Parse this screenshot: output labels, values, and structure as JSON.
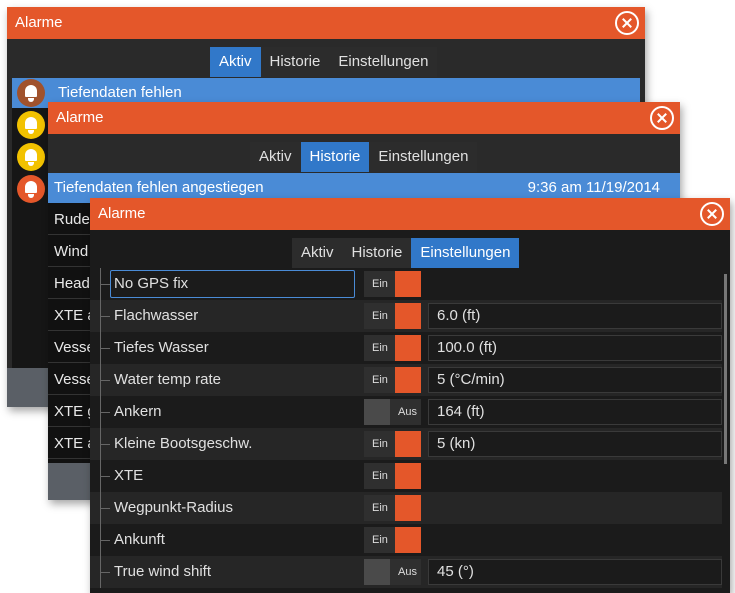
{
  "windows": {
    "active": {
      "title": "Alarme",
      "tabs": [
        "Aktiv",
        "Historie",
        "Einstellungen"
      ],
      "active_tab": "Aktiv",
      "alarm_text": "Tiefendaten fehlen",
      "bell_colors": [
        "#a0522d",
        "#f2c200",
        "#f2c200",
        "#e4572a"
      ]
    },
    "history": {
      "title": "Alarme",
      "tabs": [
        "Aktiv",
        "Historie",
        "Einstellungen"
      ],
      "active_tab": "Historie",
      "selected": {
        "text": "Tiefendaten fehlen angestiegen",
        "time": "9:36 am 11/19/2014"
      },
      "items": [
        "Rude",
        "Wind",
        "Head",
        "XTE a",
        "Vesse",
        "Vesse",
        "XTE g",
        "XTE a"
      ]
    },
    "settings": {
      "title": "Alarme",
      "tabs": [
        "Aktiv",
        "Historie",
        "Einstellungen"
      ],
      "active_tab": "Einstellungen",
      "on_label": "Ein",
      "off_label": "Aus",
      "rows": [
        {
          "name": "No GPS fix",
          "state": "on",
          "value": null,
          "selected": true
        },
        {
          "name": "Flachwasser",
          "state": "on",
          "value": "6.0 (ft)"
        },
        {
          "name": "Tiefes Wasser",
          "state": "on",
          "value": "100.0 (ft)"
        },
        {
          "name": "Water temp rate",
          "state": "on",
          "value": "5 (°C/min)"
        },
        {
          "name": "Ankern",
          "state": "off",
          "value": "164 (ft)"
        },
        {
          "name": "Kleine Bootsgeschw.",
          "state": "on",
          "value": "5 (kn)"
        },
        {
          "name": "XTE",
          "state": "on",
          "value": null
        },
        {
          "name": "Wegpunkt-Radius",
          "state": "on",
          "value": null
        },
        {
          "name": "Ankunft",
          "state": "on",
          "value": null
        },
        {
          "name": "True wind shift",
          "state": "off",
          "value": "45 (°)"
        }
      ]
    }
  },
  "colors": {
    "titlebar": "#e4572a",
    "active_tab": "#3178c9",
    "selected_row": "#4a8bd6",
    "toggle_on": "#e4572a"
  },
  "icons": {
    "close": "close-icon",
    "alarm": "bell-icon"
  }
}
